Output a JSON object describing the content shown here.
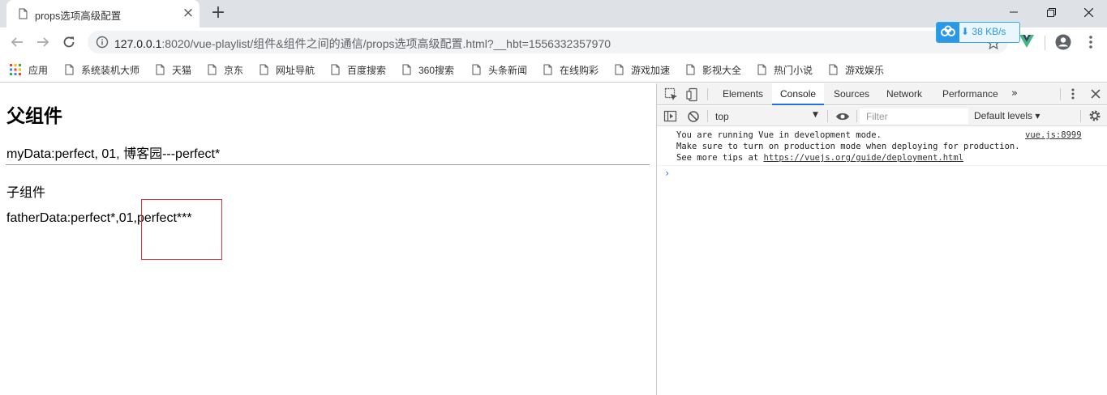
{
  "browser": {
    "tab_title": "props选项高级配置",
    "new_tab_symbol": "+",
    "tab_close_symbol": "×",
    "url_host": "127.0.0.1",
    "url_rest": ":8020/vue-playlist/组件&组件之间的通信/props选项高级配置.html?__hbt=1556332357970",
    "download_speed": "38 KB/s"
  },
  "bookmarks": [
    {
      "label": "应用",
      "icon": "apps-grid-icon"
    },
    {
      "label": "系统装机大师",
      "icon": "page-icon"
    },
    {
      "label": "天猫",
      "icon": "page-icon"
    },
    {
      "label": "京东",
      "icon": "page-icon"
    },
    {
      "label": "网址导航",
      "icon": "page-icon"
    },
    {
      "label": "百度搜索",
      "icon": "page-icon"
    },
    {
      "label": "360搜索",
      "icon": "page-icon"
    },
    {
      "label": "头条新闻",
      "icon": "page-icon"
    },
    {
      "label": "在线购彩",
      "icon": "page-icon"
    },
    {
      "label": "游戏加速",
      "icon": "page-icon"
    },
    {
      "label": "影视大全",
      "icon": "page-icon"
    },
    {
      "label": "热门小说",
      "icon": "page-icon"
    },
    {
      "label": "游戏娱乐",
      "icon": "page-icon"
    }
  ],
  "page": {
    "parent_heading": "父组件",
    "my_data_line": "myData:perfect, 01, 博客园---perfect*",
    "child_heading": "子组件",
    "father_data_line": "fatherData:perfect*,01,perfect***"
  },
  "devtools": {
    "tabs": [
      "Elements",
      "Console",
      "Sources",
      "Network",
      "Performance"
    ],
    "active_tab": "Console",
    "more_tabs": "»",
    "context": "top",
    "filter_placeholder": "Filter",
    "levels": "Default levels ▾",
    "console": {
      "line1": "You are running Vue in development mode.",
      "line2": "Make sure to turn on production mode when deploying for production.",
      "line3_prefix": "See more tips at ",
      "line3_link": "https://vuejs.org/guide/deployment.html",
      "source": "vue.js:8999",
      "prompt": "›"
    }
  },
  "colors": {
    "accent": "#1a73e8",
    "highlight_border": "#d9363e",
    "vue_green": "#41b883",
    "speed_blue": "#2a97e8"
  }
}
